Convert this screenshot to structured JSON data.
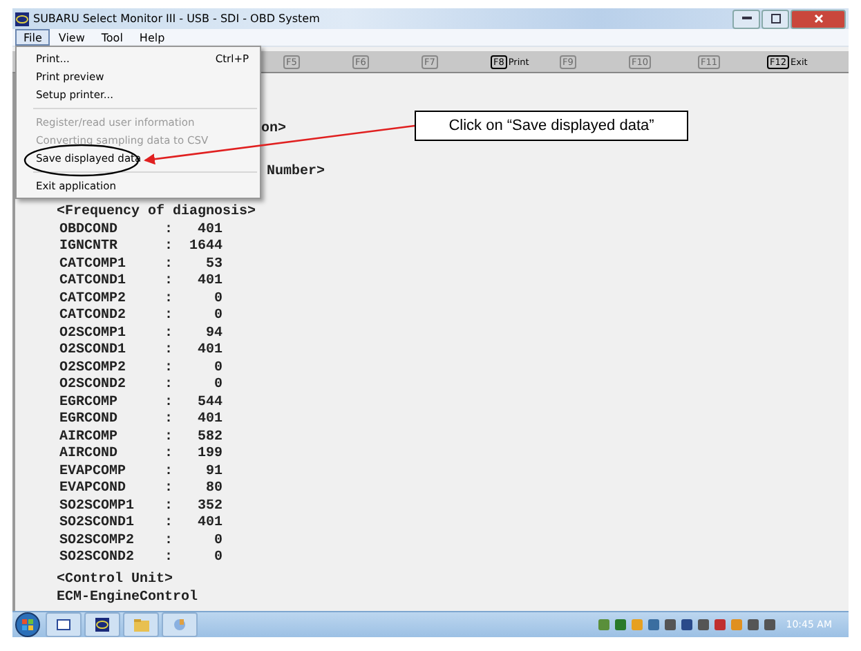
{
  "window": {
    "title": "SUBARU Select Monitor III - USB - SDI - OBD System"
  },
  "menu_bar": [
    {
      "label": "File",
      "selected": true
    },
    {
      "label": "View",
      "selected": false
    },
    {
      "label": "Tool",
      "selected": false
    },
    {
      "label": "Help",
      "selected": false
    }
  ],
  "file_menu": [
    {
      "kind": "item",
      "label": "Print...",
      "shortcut": "Ctrl+P",
      "disabled": false
    },
    {
      "kind": "item",
      "label": "Print preview",
      "disabled": false
    },
    {
      "kind": "item",
      "label": "Setup printer...",
      "disabled": false
    },
    {
      "kind": "separator"
    },
    {
      "kind": "item",
      "label": "Register/read user information",
      "disabled": true
    },
    {
      "kind": "item",
      "label": "Converting sampling data to CSV",
      "disabled": true
    },
    {
      "kind": "item",
      "label": "Save displayed data",
      "disabled": false
    },
    {
      "kind": "separator"
    },
    {
      "kind": "item",
      "label": "Exit application",
      "disabled": false
    }
  ],
  "function_keys": [
    {
      "key": "F5",
      "disabled": true
    },
    {
      "key": "F6",
      "disabled": true
    },
    {
      "key": "F7",
      "disabled": true
    },
    {
      "key": "F8",
      "label": "Print",
      "disabled": false
    },
    {
      "key": "F9",
      "disabled": true
    },
    {
      "key": "F10",
      "disabled": true
    },
    {
      "key": "F11",
      "disabled": true
    },
    {
      "key": "F12",
      "label": "Exit",
      "disabled": false
    }
  ],
  "report": {
    "partial_lines": [
      "on>",
      "Number>"
    ],
    "section_title": "<Frequency of diagnosis>",
    "rows": [
      {
        "name": "OBDCOND",
        "sep": ":",
        "value": "401"
      },
      {
        "name": "IGNCNTR",
        "sep": ":",
        "value": "1644"
      },
      {
        "name": "CATCOMP1",
        "sep": ":",
        "value": "53"
      },
      {
        "name": "CATCOND1",
        "sep": ":",
        "value": "401"
      },
      {
        "name": "CATCOMP2",
        "sep": ":",
        "value": "0"
      },
      {
        "name": "CATCOND2",
        "sep": ":",
        "value": "0"
      },
      {
        "name": "O2SCOMP1",
        "sep": ":",
        "value": "94"
      },
      {
        "name": "O2SCOND1",
        "sep": ":",
        "value": "401"
      },
      {
        "name": "O2SCOMP2",
        "sep": ":",
        "value": "0"
      },
      {
        "name": "O2SCOND2",
        "sep": ":",
        "value": "0"
      },
      {
        "name": "EGRCOMP",
        "sep": ":",
        "value": "544"
      },
      {
        "name": "EGRCOND",
        "sep": ":",
        "value": "401"
      },
      {
        "name": "AIRCOMP",
        "sep": ":",
        "value": "582"
      },
      {
        "name": "AIRCOND",
        "sep": ":",
        "value": "199"
      },
      {
        "name": "EVAPCOMP",
        "sep": ":",
        "value": "91"
      },
      {
        "name": "EVAPCOND",
        "sep": ":",
        "value": "80"
      },
      {
        "name": "SO2SCOMP1",
        "sep": ":",
        "value": "352"
      },
      {
        "name": "SO2SCOND1",
        "sep": ":",
        "value": "401"
      },
      {
        "name": "SO2SCOMP2",
        "sep": ":",
        "value": "0"
      },
      {
        "name": "SO2SCOND2",
        "sep": ":",
        "value": "0"
      }
    ],
    "control_unit_title": "<Control Unit>",
    "control_unit": "ECM-EngineControl"
  },
  "callout": {
    "text": "Click on “Save displayed data”"
  },
  "taskbar": {
    "clock": "10:45 AM"
  }
}
